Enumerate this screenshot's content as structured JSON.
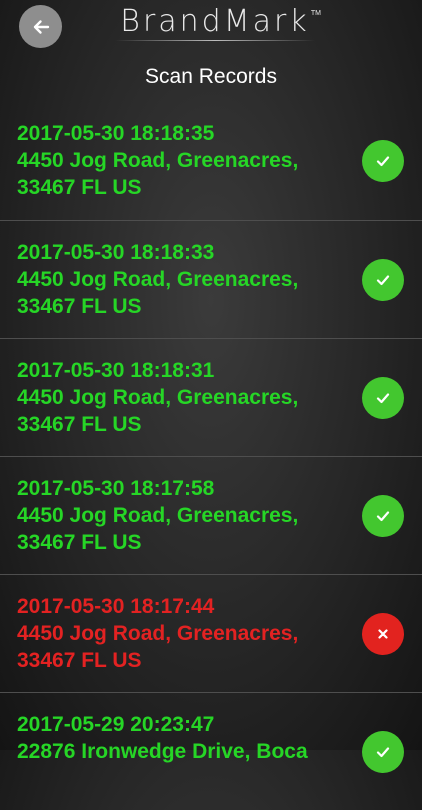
{
  "header": {
    "back_icon": "arrow-left-icon",
    "brand": "BrandMark",
    "brand_tm": "TM",
    "title": "Scan Records"
  },
  "colors": {
    "success_text": "#26d626",
    "failure_text": "#e32222",
    "success_badge": "#43c72f",
    "failure_badge": "#e2231f"
  },
  "records": [
    {
      "timestamp": "2017-05-30  18:18:35",
      "address_line1": "4450 Jog Road, Greenacres,",
      "address_line2": "33467 FL US",
      "status": "success",
      "status_icon": "check-icon"
    },
    {
      "timestamp": "2017-05-30  18:18:33",
      "address_line1": "4450 Jog Road, Greenacres,",
      "address_line2": "33467 FL US",
      "status": "success",
      "status_icon": "check-icon"
    },
    {
      "timestamp": "2017-05-30  18:18:31",
      "address_line1": "4450 Jog Road, Greenacres,",
      "address_line2": "33467 FL US",
      "status": "success",
      "status_icon": "check-icon"
    },
    {
      "timestamp": "2017-05-30  18:17:58",
      "address_line1": "4450 Jog Road, Greenacres,",
      "address_line2": "33467 FL US",
      "status": "success",
      "status_icon": "check-icon"
    },
    {
      "timestamp": "2017-05-30  18:17:44",
      "address_line1": "4450 Jog Road, Greenacres,",
      "address_line2": "33467 FL US",
      "status": "failure",
      "status_icon": "close-icon"
    },
    {
      "timestamp": "2017-05-29  20:23:47",
      "address_line1": "22876 Ironwedge Drive, Boca",
      "address_line2": "",
      "status": "success",
      "status_icon": "check-icon"
    }
  ]
}
